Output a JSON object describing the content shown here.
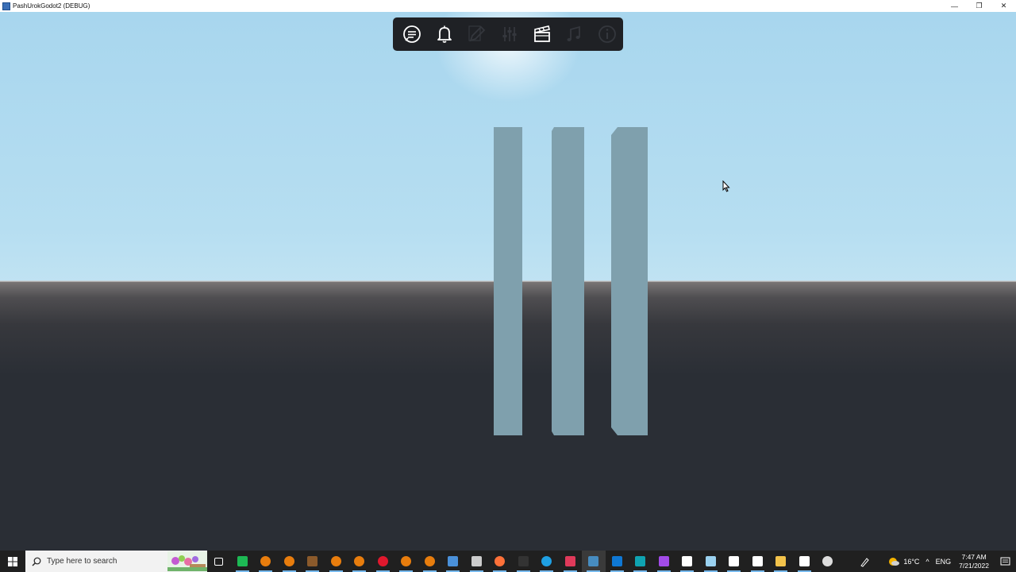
{
  "window": {
    "title": "PashUrokGodot2 (DEBUG)",
    "controls": {
      "minimize": "—",
      "restore": "❐",
      "close": "✕"
    }
  },
  "toolbar": {
    "buttons": [
      {
        "icon": "chat-bubble-icon",
        "enabled": true
      },
      {
        "icon": "bell-icon",
        "enabled": true
      },
      {
        "icon": "pencil-icon",
        "enabled": false
      },
      {
        "icon": "sliders-icon",
        "enabled": false
      },
      {
        "icon": "clapperboard-icon",
        "enabled": true
      },
      {
        "icon": "music-notes-icon",
        "enabled": false
      },
      {
        "icon": "info-circle-icon",
        "enabled": false
      }
    ]
  },
  "scene": {
    "objects": [
      "pillar-left",
      "pillar-middle",
      "pillar-right"
    ],
    "colors": {
      "pillar": "#7fa0ad",
      "sky": "#a8d6ee",
      "ground": "#2a2e35"
    }
  },
  "taskbar": {
    "search_placeholder": "Type here to search",
    "apps": [
      {
        "name": "task-view-icon",
        "color": "#ffffff"
      },
      {
        "name": "green-app-icon",
        "color": "#1db954"
      },
      {
        "name": "blender-icon",
        "color": "#e87d0d"
      },
      {
        "name": "blender-icon",
        "color": "#e87d0d"
      },
      {
        "name": "brown-app-icon",
        "color": "#8b5a2b"
      },
      {
        "name": "blender-icon",
        "color": "#e87d0d"
      },
      {
        "name": "blender-icon",
        "color": "#e87d0d"
      },
      {
        "name": "opera-icon",
        "color": "#e0182d"
      },
      {
        "name": "blender-icon",
        "color": "#e87d0d"
      },
      {
        "name": "blender-icon",
        "color": "#e87d0d"
      },
      {
        "name": "app-blue-icon",
        "color": "#4a90d9"
      },
      {
        "name": "film-app-icon",
        "color": "#cccccc"
      },
      {
        "name": "firefox-icon",
        "color": "#ff7139"
      },
      {
        "name": "epic-games-icon",
        "color": "#333333"
      },
      {
        "name": "edge-icon",
        "color": "#1fa0e3"
      },
      {
        "name": "red-circle-app-icon",
        "color": "#e03a5a"
      },
      {
        "name": "godot-icon",
        "color": "#478cbf"
      },
      {
        "name": "mail-icon",
        "color": "#0f78d4"
      },
      {
        "name": "teal-app-icon",
        "color": "#0fa3b1"
      },
      {
        "name": "color-drop-icon",
        "color": "#a24be8"
      },
      {
        "name": "vscode-icon",
        "color": "#ffffff"
      },
      {
        "name": "notepad-icon",
        "color": "#9ad1ef"
      },
      {
        "name": "unity-icon",
        "color": "#ffffff"
      },
      {
        "name": "clapper-app-icon",
        "color": "#ffffff"
      },
      {
        "name": "file-explorer-icon",
        "color": "#f3c34b"
      },
      {
        "name": "unreal-icon",
        "color": "#ffffff"
      },
      {
        "name": "obs-icon",
        "color": "#dddddd"
      }
    ],
    "tray": {
      "pen_icon": "pen-icon",
      "weather_icon": "weather-sun-icon",
      "temperature": "16°C",
      "chevron": "^",
      "language": "ENG",
      "time": "7:47 AM",
      "date": "7/21/2022",
      "notifications_icon": "notification-icon"
    }
  }
}
